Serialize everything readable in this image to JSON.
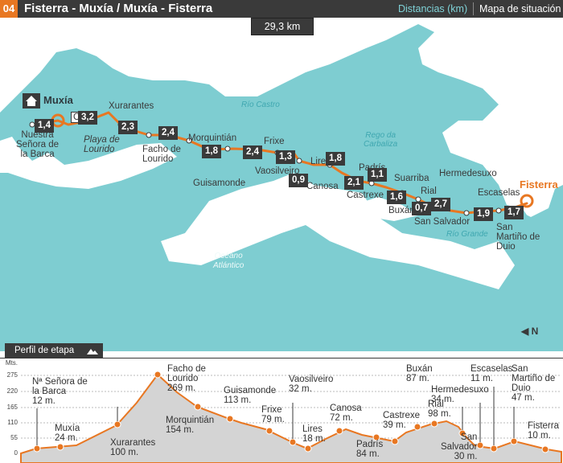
{
  "header": {
    "stage_number": "04",
    "title": "Fisterra - Muxía / Muxía - Fisterra",
    "distances_link": "Distancias (km)",
    "map_link": "Mapa de situación"
  },
  "map": {
    "total_distance": "29,3 km",
    "segments": [
      "1,4",
      "3,2",
      "2,3",
      "2,4",
      "1,8",
      "2,4",
      "1,3",
      "0,9",
      "1,8",
      "2,1",
      "1,1",
      "1,6",
      "0,7",
      "2,7",
      "1,9",
      "1,7"
    ],
    "places": {
      "muxia": "Muxía",
      "fisterra": "Fisterra",
      "barca": "Nuestra\nSeñora de\nla Barca",
      "lourido_beach": "Playa de\nLourido",
      "xurarantes": "Xurarantes",
      "facho": "Facho de\nLourido",
      "morquintian": "Morquintián",
      "guisamonde": "Guisamonde",
      "frixe": "Frixe",
      "vaosilveiro": "Vaosilveiro",
      "lires": "Lires",
      "canosa": "Canosa",
      "padris": "Padrís",
      "castrexe": "Castrexe",
      "suarriba": "Suarriba",
      "buxan": "Buxán",
      "rial": "Rial",
      "san_salvador": "San Salvador",
      "hermedesuxo": "Hermedesuxo",
      "escaselas": "Escaselas",
      "san_martino": "San\nMartiño de\nDuio",
      "c_partial": "C"
    },
    "water": {
      "rio_castro": "Río Castro",
      "rego_carbaliza": "Rego da\nCarbaliza",
      "rio_grande": "Río Grande",
      "ocean": "Océano\nAtlántico"
    },
    "north_label": "N",
    "colors": {
      "sea": "#7ecdd1",
      "land": "#ffffff",
      "route": "#e87722"
    }
  },
  "profile": {
    "tab_label": "Perfil de etapa",
    "axis_unit": "Mts.",
    "axis_ticks": [
      "275",
      "220",
      "165",
      "110",
      "55",
      "0"
    ],
    "labels": [
      "Nª Señora de\nla Barca\n12 m.",
      "Muxía\n24 m.",
      "Xurarantes\n100 m.",
      "Facho de\nLourido\n269 m.",
      "Morquintián\n154 m.",
      "Guisamonde\n113 m.",
      "Frixe\n79 m.",
      "Vaosilveiro\n32 m.",
      "Lires\n18 m.",
      "Canosa\n72 m.",
      "Padrís\n84 m.",
      "Castrexe\n39 m.",
      "Buxán\n87 m.",
      "Rial\n98 m.",
      "Hermedesuxo\n34 m.",
      "San\nSalvador\n30 m.",
      "Escaselas\n11 m.",
      "San\nMartiño de\nDuio\n47 m.",
      "Fisterra\n10 m."
    ]
  }
}
